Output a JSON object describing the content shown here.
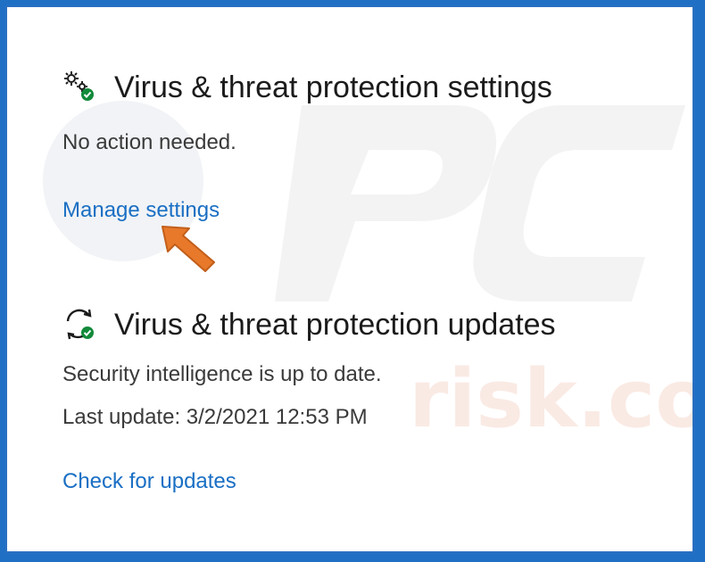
{
  "settings_section": {
    "title": "Virus & threat protection settings",
    "status": "No action needed.",
    "link": "Manage settings",
    "icon": "gears-check-icon"
  },
  "updates_section": {
    "title": "Virus & threat protection updates",
    "status": "Security intelligence is up to date.",
    "last_update": "Last update: 3/2/2021 12:53 PM",
    "link": "Check for updates",
    "icon": "refresh-check-icon"
  },
  "colors": {
    "link": "#1a6fc4",
    "check_badge": "#128a3a",
    "arrow": "#e8792a",
    "frame_border": "#2a6fc0"
  }
}
